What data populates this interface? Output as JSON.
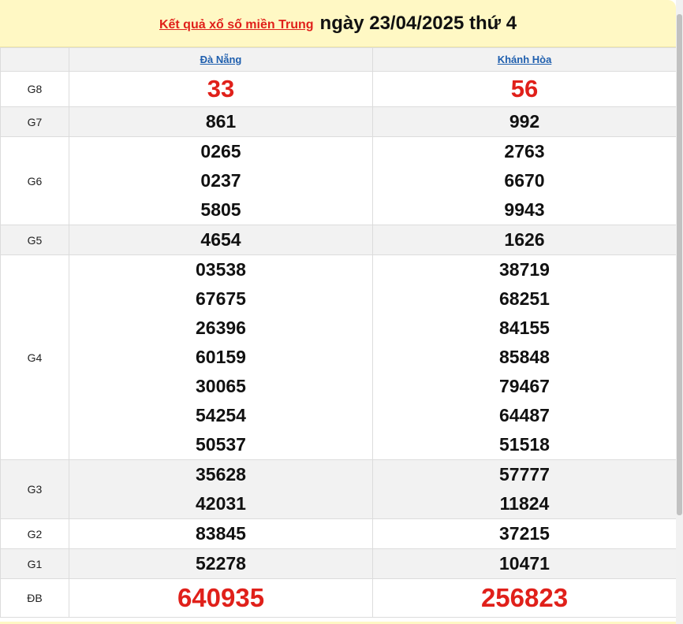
{
  "header": {
    "link_text": "Kết quả xổ số miền Trung",
    "date_text": "ngày 23/04/2025 thứ 4"
  },
  "provinces": [
    "Đà Nẵng",
    "Khánh Hòa"
  ],
  "prizes": [
    {
      "label": "G8",
      "da_nang": [
        "33"
      ],
      "khanh_hoa": [
        "56"
      ]
    },
    {
      "label": "G7",
      "da_nang": [
        "861"
      ],
      "khanh_hoa": [
        "992"
      ]
    },
    {
      "label": "G6",
      "da_nang": [
        "0265",
        "0237",
        "5805"
      ],
      "khanh_hoa": [
        "2763",
        "6670",
        "9943"
      ]
    },
    {
      "label": "G5",
      "da_nang": [
        "4654"
      ],
      "khanh_hoa": [
        "1626"
      ]
    },
    {
      "label": "G4",
      "da_nang": [
        "03538",
        "67675",
        "26396",
        "60159",
        "30065",
        "54254",
        "50537"
      ],
      "khanh_hoa": [
        "38719",
        "68251",
        "84155",
        "85848",
        "79467",
        "64487",
        "51518"
      ]
    },
    {
      "label": "G3",
      "da_nang": [
        "35628",
        "42031"
      ],
      "khanh_hoa": [
        "57777",
        "11824"
      ]
    },
    {
      "label": "G2",
      "da_nang": [
        "83845"
      ],
      "khanh_hoa": [
        "37215"
      ]
    },
    {
      "label": "G1",
      "da_nang": [
        "52278"
      ],
      "khanh_hoa": [
        "10471"
      ]
    },
    {
      "label": "ĐB",
      "da_nang": [
        "640935"
      ],
      "khanh_hoa": [
        "256823"
      ]
    }
  ],
  "colors": {
    "header_bg": "#fff8c4",
    "accent_red": "#e0201a",
    "link_blue": "#1f5fae",
    "alt_row": "#f2f2f2"
  }
}
